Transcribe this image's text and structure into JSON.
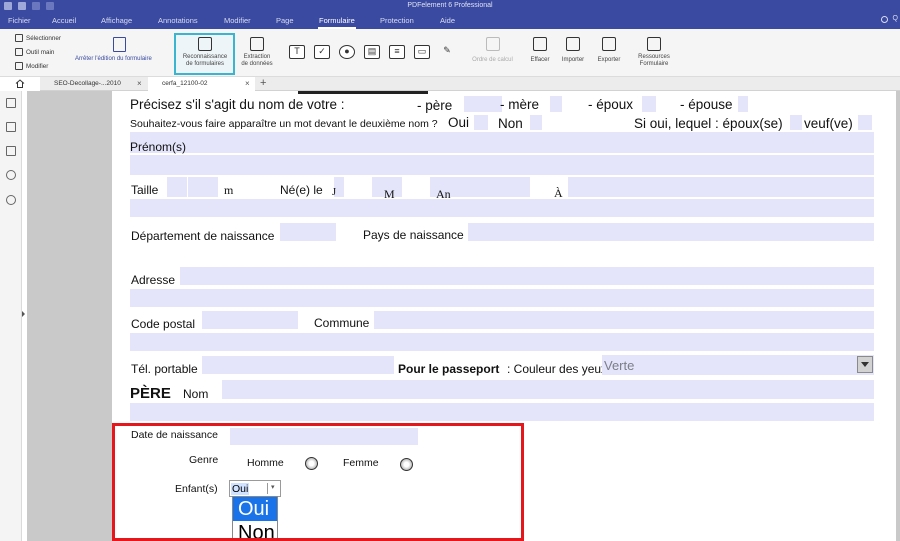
{
  "app": {
    "title": "PDFelement 6 Professional"
  },
  "menu": {
    "items": [
      "Fichier",
      "Accueil",
      "Affichage",
      "Annotations",
      "Modifier",
      "Page",
      "Formulaire",
      "Protection",
      "Aide"
    ],
    "active": "Formulaire",
    "help_label": "Q"
  },
  "ribbon": {
    "selectionner": "Sélectionner",
    "outil_main": "Outil main",
    "modifier": "Modifier",
    "stop_edit": "Arrêter l'édition du formulaire",
    "reconnaissance_line1": "Reconnaissance",
    "reconnaissance_line2": "de formulaires",
    "extraction_line1": "Extraction",
    "extraction_line2": "de données",
    "ordre": "Ordre de calcul",
    "effacer": "Effacer",
    "importer": "Importer",
    "exporter": "Exporter",
    "ressources_line1": "Ressources",
    "ressources_line2": "Formulaire",
    "field_tools": [
      "T",
      "✓",
      "●",
      "▤",
      "≡",
      "▭",
      "✎"
    ]
  },
  "tabs": {
    "items": [
      "SEO-Decollage-...2010",
      "cerfa_12100-02"
    ],
    "active": "cerfa_12100-02"
  },
  "form": {
    "q_nom": "Précisez s'il s'agit du nom de votre :",
    "pere_opt": "- père",
    "mere_opt": "- mère",
    "epoux_opt": "- époux",
    "epouse_opt": "- épouse",
    "q_mot": "Souhaitez-vous faire apparaître un mot devant le deuxième nom ?",
    "oui": "Oui",
    "non": "Non",
    "si_oui": "Si oui, lequel : époux(se)",
    "veuf": "veuf(ve)",
    "prenoms": "Prénom(s)",
    "taille": "Taille",
    "m": "m",
    "ne_le": "Né(e) le",
    "j": "J",
    "mo": "M",
    "an": "An",
    "a": "À",
    "departement": "Département de naissance",
    "pays": "Pays de naissance",
    "adresse": "Adresse",
    "code_postal": "Code postal",
    "commune": "Commune",
    "tel": "Tél. portable",
    "passeport": "Pour le passeport",
    "couleur": ": Couleur des yeux",
    "couleur_value": "Verte",
    "pere": "PÈRE",
    "nom": "Nom",
    "date_naissance": "Date de naissance",
    "genre": "Genre",
    "homme": "Homme",
    "femme": "Femme",
    "enfants": "Enfant(s)",
    "enfants_value": "Oui",
    "enfants_options": [
      "Oui",
      "Non"
    ]
  }
}
